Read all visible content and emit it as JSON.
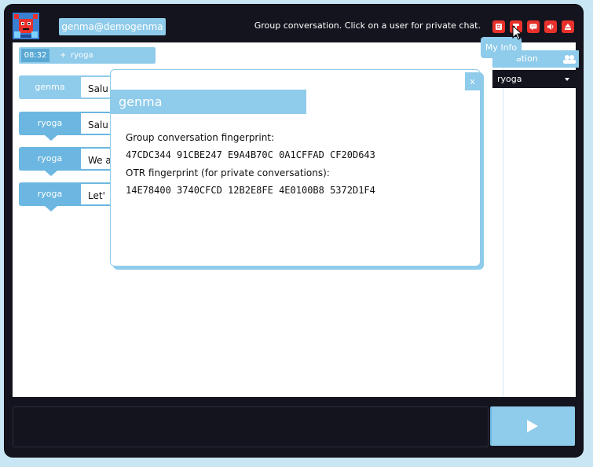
{
  "header": {
    "user_id": "genma@demogenma",
    "status_message": "Group conversation. Click on a user for private chat.",
    "tooltip": "My Info",
    "icons": [
      "user-icon",
      "info-icon",
      "chat-icon",
      "sound-icon",
      "logout-icon"
    ],
    "icon_color": "#e8312b"
  },
  "sidebar": {
    "header_label": "ation",
    "selected_user": "ryoga"
  },
  "chat": {
    "notice": {
      "time": "08:32",
      "arrow": "+",
      "name": "ryoga"
    },
    "messages": [
      {
        "sender": "genma",
        "text": "Salu"
      },
      {
        "sender": "ryoga",
        "text": "Salu"
      },
      {
        "sender": "ryoga",
        "text": "We a"
      },
      {
        "sender": "ryoga",
        "text": "Let'"
      }
    ]
  },
  "modal": {
    "title": "genma",
    "close_label": "x",
    "group_label": "Group conversation fingerprint:",
    "group_fingerprint": "47CDC344 91CBE247 E9A4B70C 0A1CFFAD CF20D643",
    "otr_label": "OTR fingerprint (for private conversations):",
    "otr_fingerprint": "14E78400 3740CFCD 12B2E8FE 4E0100B8 5372D1F4"
  },
  "composer": {
    "send_icon": "send-icon"
  },
  "colors": {
    "accent": "#8fcbea",
    "dark": "#14141e",
    "page_bg": "#c9e6f5"
  }
}
